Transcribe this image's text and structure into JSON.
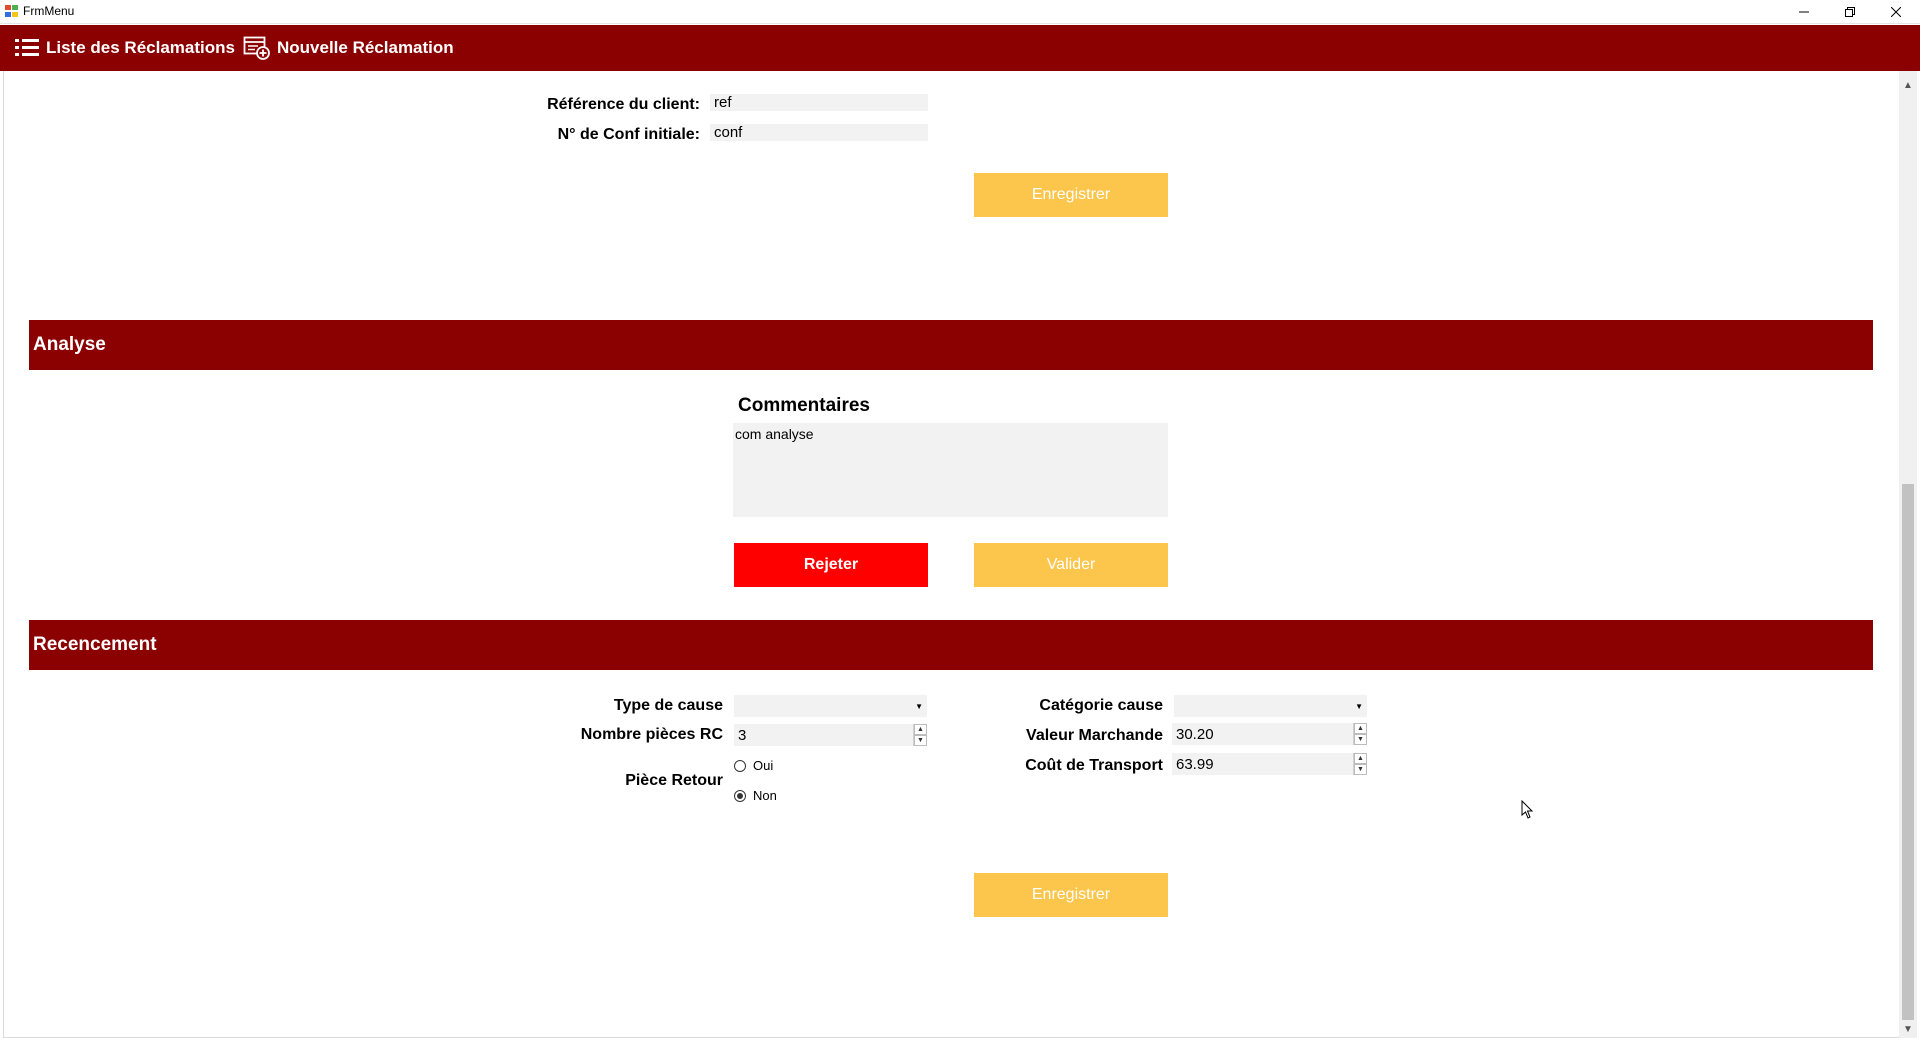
{
  "window": {
    "title": "FrmMenu"
  },
  "menu": {
    "liste_label": "Liste des Réclamations",
    "nouvelle_label": "Nouvelle Réclamation"
  },
  "client": {
    "ref_label": "Référence du client:",
    "ref_value": "ref",
    "conf_label": "N° de Conf initiale:",
    "conf_value": "conf",
    "save_label": "Enregistrer"
  },
  "analyse": {
    "header": "Analyse",
    "comments_label": "Commentaires",
    "comments_value": "com analyse",
    "reject_label": "Rejeter",
    "validate_label": "Valider"
  },
  "recensement": {
    "header": "Recencement",
    "type_cause_label": "Type de cause",
    "type_cause_value": "",
    "nombre_pieces_label": "Nombre pièces RC",
    "nombre_pieces_value": "3",
    "piece_retour_label": "Pièce Retour",
    "radio_oui": "Oui",
    "radio_non": "Non",
    "selected_radio": "Non",
    "categorie_cause_label": "Catégorie cause",
    "categorie_cause_value": "",
    "valeur_marchande_label": "Valeur Marchande",
    "valeur_marchande_value": "30.20",
    "cout_transport_label": "Coût de Transport",
    "cout_transport_value": "63.99",
    "save_label": "Enregistrer"
  },
  "colors": {
    "brand": "#8b0000",
    "accent_yellow": "#fcc54c",
    "reject_red": "#ff0000",
    "field_bg": "#f2f2f2"
  }
}
